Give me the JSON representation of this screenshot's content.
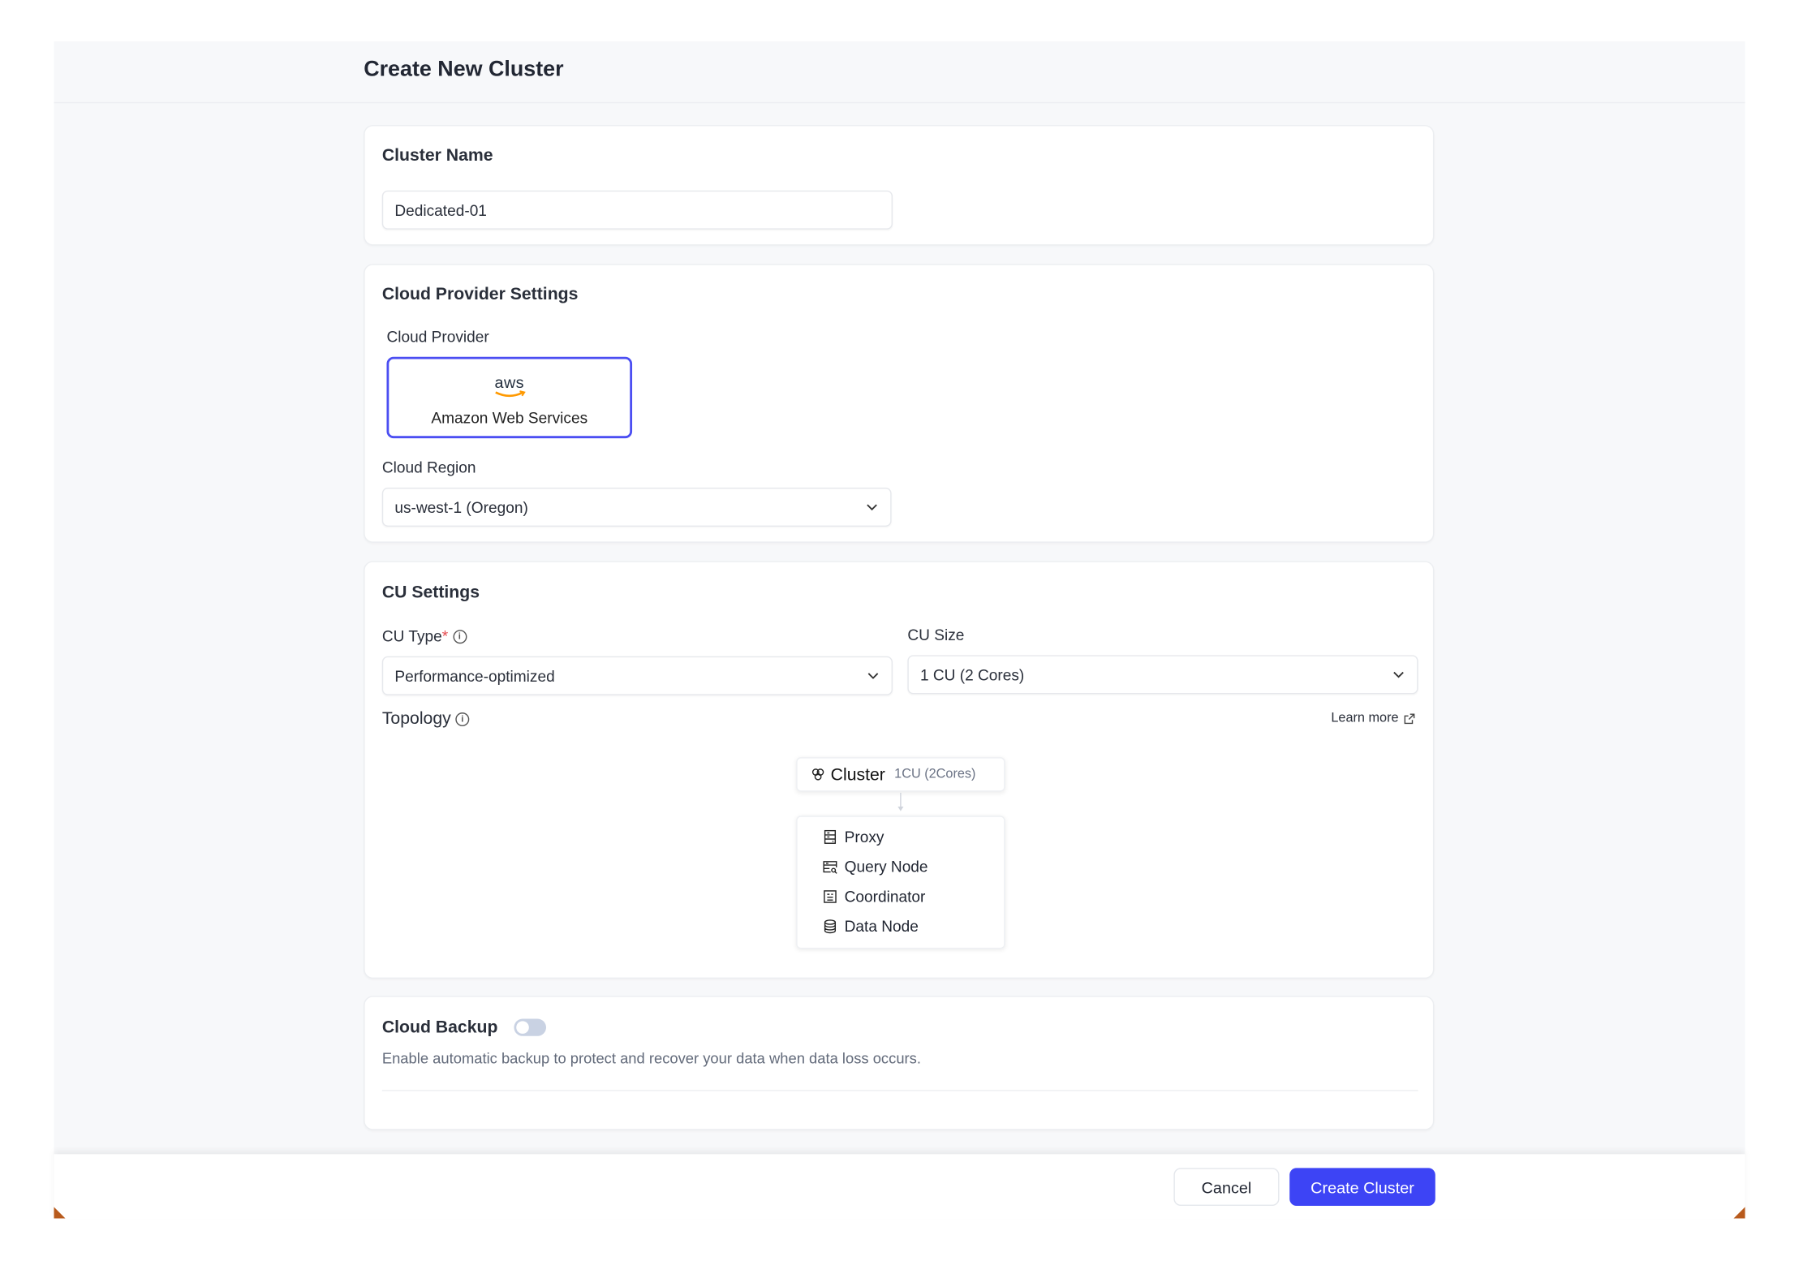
{
  "page": {
    "title": "Create New Cluster"
  },
  "cluster_name": {
    "title": "Cluster Name",
    "value": "Dedicated-01"
  },
  "cloud_provider": {
    "title": "Cloud Provider Settings",
    "provider_label": "Cloud Provider",
    "provider_logo": "aws",
    "provider_name": "Amazon Web Services",
    "region_label": "Cloud Region",
    "region_value": "us-west-1 (Oregon)",
    "accent": "#4b4ef2"
  },
  "cu_settings": {
    "title": "CU Settings",
    "cu_type_label": "CU Type",
    "required_mark": "*",
    "cu_type_value": "Performance-optimized",
    "cu_size_label": "CU Size",
    "cu_size_value": "1 CU (2 Cores)",
    "topology_label": "Topology",
    "learn_more": "Learn more",
    "topology": {
      "cluster_label": "Cluster",
      "cluster_size": "1CU (2Cores)",
      "nodes": [
        {
          "label": "Proxy",
          "icon": "server-icon"
        },
        {
          "label": "Query Node",
          "icon": "query-server-icon"
        },
        {
          "label": "Coordinator",
          "icon": "coordinator-icon"
        },
        {
          "label": "Data Node",
          "icon": "database-icon"
        }
      ]
    }
  },
  "backup": {
    "title": "Cloud Backup",
    "enabled": false,
    "description": "Enable automatic backup to protect and recover your data when data loss occurs."
  },
  "footer": {
    "cancel": "Cancel",
    "create": "Create Cluster",
    "primary_color": "#3d44f5"
  }
}
